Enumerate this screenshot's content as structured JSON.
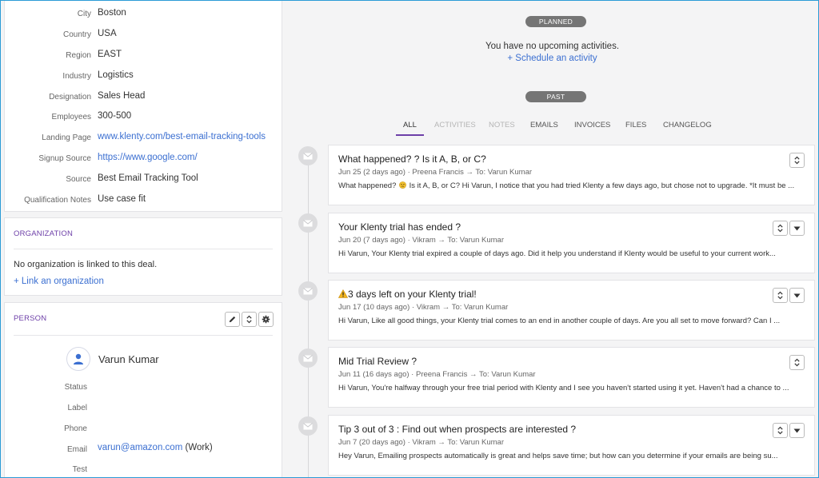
{
  "details": [
    {
      "label": "City",
      "value": "Boston",
      "link": false
    },
    {
      "label": "Country",
      "value": "USA",
      "link": false
    },
    {
      "label": "Region",
      "value": "EAST",
      "link": false
    },
    {
      "label": "Industry",
      "value": "Logistics",
      "link": false
    },
    {
      "label": "Designation",
      "value": "Sales Head",
      "link": false
    },
    {
      "label": "Employees",
      "value": "300-500",
      "link": false
    },
    {
      "label": "Landing Page",
      "value": "www.klenty.com/best-email-tracking-tools",
      "link": true
    },
    {
      "label": "Signup Source",
      "value": "https://www.google.com/",
      "link": true
    },
    {
      "label": "Source",
      "value": "Best Email Tracking Tool",
      "link": false
    },
    {
      "label": "Qualification Notes",
      "value": "Use case fit",
      "link": false
    }
  ],
  "organization": {
    "title": "ORGANIZATION",
    "message": "No organization is linked to this deal.",
    "link_label": "+ Link an organization"
  },
  "person": {
    "title": "PERSON",
    "name": "Varun Kumar",
    "status_label": "Status",
    "label_label": "Label",
    "phone_label": "Phone",
    "email_label": "Email",
    "email_value": "varun@amazon.com",
    "email_type": "(Work)",
    "test_label": "Test"
  },
  "activity": {
    "planned_label": "PLANNED",
    "no_activities": "You have no upcoming activities.",
    "schedule_link": "+ Schedule an activity",
    "past_label": "PAST",
    "tabs": [
      {
        "label": "ALL",
        "state": "active"
      },
      {
        "label": "ACTIVITIES",
        "state": "dim"
      },
      {
        "label": "NOTES",
        "state": "dim"
      },
      {
        "label": "EMAILS",
        "state": "normal"
      },
      {
        "label": "INVOICES",
        "state": "normal"
      },
      {
        "label": "FILES",
        "state": "normal"
      },
      {
        "label": "CHANGELOG",
        "state": "normal"
      }
    ]
  },
  "emails": [
    {
      "title": "What happened? ? Is it A, B, or C?",
      "meta": "Jun 25 (2 days ago) · Preena Francis → To: Varun Kumar",
      "snippet_pre": "What happened?",
      "snippet_post": "Is it A, B, or C? Hi Varun, I notice that you had tried Klenty a few days ago, but chose not to upgrade. *It must be ...",
      "emoji": "confused-emoji-icon",
      "warning": false,
      "dropdown": false
    },
    {
      "title": "Your Klenty trial has ended ?",
      "meta": "Jun 20 (7 days ago) · Vikram → To: Varun Kumar",
      "snippet_pre": "",
      "snippet_post": "Hi Varun, Your Klenty trial expired a couple of days ago. Did it help you understand if Klenty would be useful to your current work...",
      "emoji": "",
      "warning": false,
      "dropdown": true
    },
    {
      "title": "3 days left on your Klenty trial!",
      "meta": "Jun 17 (10 days ago) · Vikram → To: Varun Kumar",
      "snippet_pre": "",
      "snippet_post": "Hi Varun, Like all good things, your Klenty trial comes to an end in another couple of days. Are you all set to move forward? Can I ...",
      "emoji": "",
      "warning": true,
      "dropdown": true
    },
    {
      "title": "Mid Trial Review ?",
      "meta": "Jun 11 (16 days ago) · Preena Francis → To: Varun Kumar",
      "snippet_pre": "",
      "snippet_post": "Hi Varun, You're halfway through your free trial period with Klenty and I see you haven't started using it yet. Haven't had a chance to ...",
      "emoji": "",
      "warning": false,
      "dropdown": false
    },
    {
      "title": "Tip 3 out of 3 : Find out when prospects are interested ?",
      "meta": "Jun 7 (20 days ago) · Vikram → To: Varun Kumar",
      "snippet_pre": "",
      "snippet_post": "Hey Varun, Emailing prospects automatically is great and helps save time; but how can you determine if your emails are being su...",
      "emoji": "",
      "warning": false,
      "dropdown": true
    }
  ],
  "colors": {
    "accent": "#6d3fa8",
    "link": "#3b6fd1",
    "pill": "#757575",
    "frame": "#2b9bd6"
  }
}
